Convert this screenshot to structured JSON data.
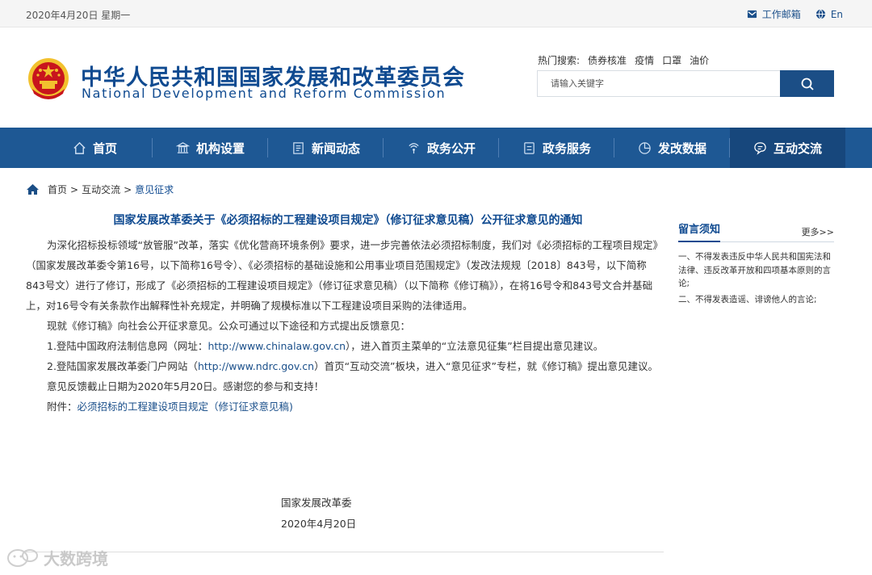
{
  "topbar": {
    "date": "2020年4月20日 星期一",
    "mail_label": "工作邮箱",
    "lang_label": "En"
  },
  "header": {
    "title_cn": "中华人民共和国国家发展和改革委员会",
    "title_en": "National Development and Reform Commission",
    "hot_label": "热门搜索:",
    "hot_items": [
      "债券核准",
      "疫情",
      "口罩",
      "油价"
    ],
    "search_placeholder": "请输入关键字"
  },
  "nav": {
    "items": [
      {
        "label": "首页",
        "icon": "home-icon"
      },
      {
        "label": "机构设置",
        "icon": "building-icon"
      },
      {
        "label": "新闻动态",
        "icon": "news-icon"
      },
      {
        "label": "政务公开",
        "icon": "signal-icon"
      },
      {
        "label": "政务服务",
        "icon": "service-icon"
      },
      {
        "label": "发改数据",
        "icon": "pie-chart-icon"
      },
      {
        "label": "互动交流",
        "icon": "chat-icon"
      }
    ],
    "active_index": 6
  },
  "breadcrumb": {
    "home": "首页",
    "sep1": ">",
    "section": "互动交流",
    "sep2": ">",
    "current": "意见征求"
  },
  "article": {
    "title": "国家发展改革委关于《必须招标的工程建设项目规定》（修订征求意见稿）公开征求意见的通知",
    "p1": "为深化招标投标领域“放管服”改革，落实《优化营商环境条例》要求，进一步完善依法必须招标制度，我们对《必须招标的工程项目规定》（国家发展改革委令第16号，以下简称16号令）、《必须招标的基础设施和公用事业项目范围规定》（发改法规规〔2018〕843号，以下简称843号文）进行了修订，形成了《必须招标的工程建设项目规定》（修订征求意见稿）（以下简称《修订稿》），在将16号令和843号文合并基础上，对16号令有关条款作出解释性补充规定，并明确了规模标准以下工程建设项目采购的法律适用。",
    "p2": "现就《修订稿》向社会公开征求意见。公众可通过以下途径和方式提出反馈意见：",
    "p3_pre": "1.登陆中国政府法制信息网（网址：",
    "p3_link": "http://www.chinalaw.gov.cn",
    "p3_post": "），进入首页主菜单的“立法意见征集”栏目提出意见建议。",
    "p4_pre": "2.登陆国家发展改革委门户网站（",
    "p4_link": "http://www.ndrc.gov.cn",
    "p4_post": "）首页“互动交流”板块，进入“意见征求”专栏，就《修订稿》提出意见建议。",
    "p5": "意见反馈截止日期为2020年5月20日。感谢您的参与和支持！",
    "attach_label": "附件：",
    "attach_link": "必须招标的工程建设项目规定（修订征求意见稿)",
    "sign_org": "国家发展改革委",
    "sign_date": "2020年4月20日"
  },
  "sidebar": {
    "title": "留言须知",
    "more": "更多>>",
    "items": [
      "一、不得发表违反中华人民共和国宪法和法律、违反改革开放和四项基本原则的言论;",
      "二、不得发表造谣、诽谤他人的言论;"
    ]
  },
  "watermark": {
    "text": "大数跨境"
  },
  "colors": {
    "brand_blue": "#0f4a90",
    "nav_bg": "#1e5894",
    "nav_active": "#17477c",
    "emblem_red": "#c8151d",
    "emblem_gold": "#f2c12e"
  }
}
